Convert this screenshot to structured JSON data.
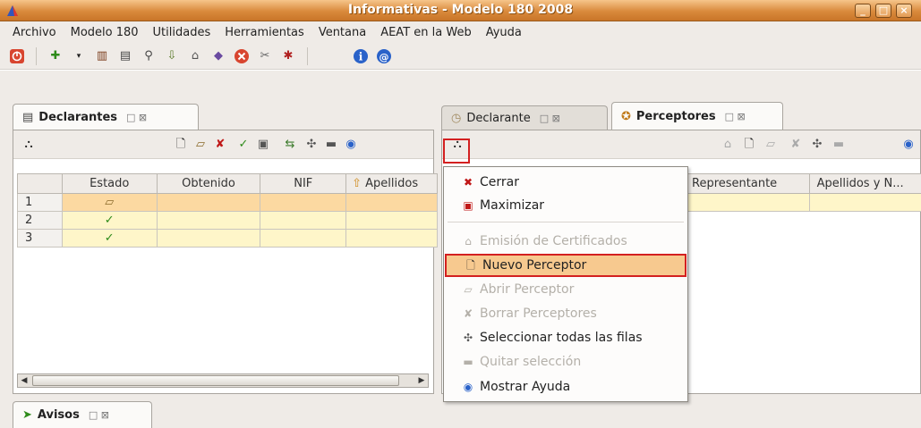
{
  "window": {
    "title": "Informativas - Modelo 180 2008",
    "buttons": [
      "_",
      "□",
      "×"
    ]
  },
  "menubar": {
    "items": [
      "Archivo",
      "Modelo 180",
      "Utilidades",
      "Herramientas",
      "Ventana",
      "AEAT en la Web",
      "Ayuda"
    ]
  },
  "left_panel": {
    "tab_label": "Declarantes",
    "tab_controls": "□ ⊠",
    "columns": [
      "",
      "Estado",
      "Obtenido",
      "NIF",
      "Apellidos"
    ],
    "rows": [
      {
        "num": "1",
        "estado": "folder-open-icon",
        "selected": true
      },
      {
        "num": "2",
        "estado": "check-icon",
        "selected": false
      },
      {
        "num": "3",
        "estado": "check-icon",
        "selected": false
      }
    ]
  },
  "right_panel": {
    "tab_declarante": "Declarante",
    "tab_perceptores": "Perceptores",
    "tab_controls": "□ ⊠",
    "columns": [
      "Representante",
      "Apellidos y N..."
    ]
  },
  "context_menu": {
    "items": [
      {
        "label": "Cerrar",
        "icon": "close-icon",
        "disabled": false
      },
      {
        "label": "Maximizar",
        "icon": "maximize-icon",
        "disabled": false
      },
      {
        "label": "Emisión de Certificados",
        "icon": "certificate-icon",
        "disabled": true
      },
      {
        "label": "Nuevo Perceptor",
        "icon": "new-document-icon",
        "disabled": false,
        "highlighted": true
      },
      {
        "label": "Abrir Perceptor",
        "icon": "open-folder-icon",
        "disabled": true
      },
      {
        "label": "Borrar Perceptores",
        "icon": "delete-icon",
        "disabled": true
      },
      {
        "label": "Seleccionar todas las filas",
        "icon": "select-all-icon",
        "disabled": false
      },
      {
        "label": "Quitar selección",
        "icon": "deselect-icon",
        "disabled": true
      },
      {
        "label": "Mostrar Ayuda",
        "icon": "help-icon",
        "disabled": false
      }
    ]
  },
  "bottom_panel": {
    "tab_label": "Avisos",
    "tab_controls": "□ ⊠"
  },
  "colors": {
    "titlebar": "#d98a3c",
    "highlight_border": "#d32020",
    "selected_row": "#fcd9a1",
    "row_bg": "#fef6c9"
  }
}
